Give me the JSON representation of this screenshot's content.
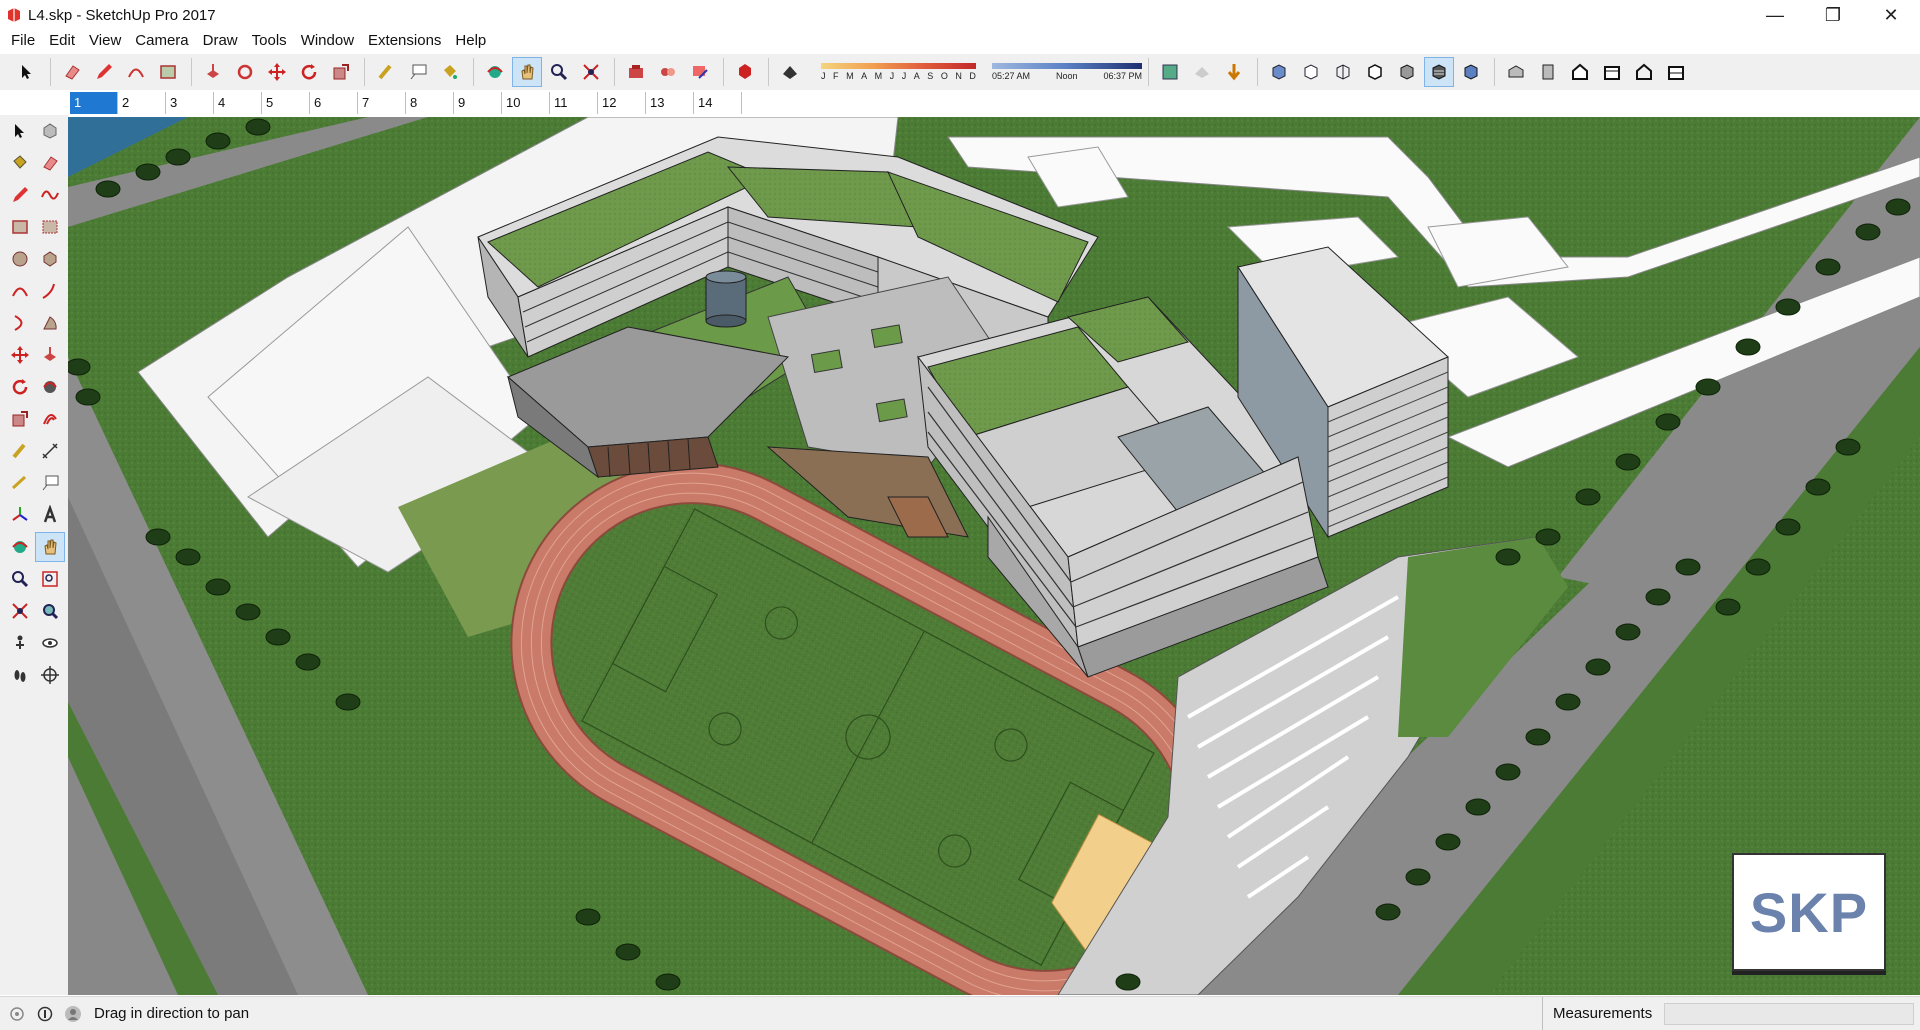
{
  "window": {
    "title": "L4.skp - SketchUp Pro 2017",
    "minimize_glyph": "—",
    "maximize_glyph": "❐",
    "close_glyph": "✕"
  },
  "menu": {
    "items": [
      "File",
      "Edit",
      "View",
      "Camera",
      "Draw",
      "Tools",
      "Window",
      "Extensions",
      "Help"
    ]
  },
  "toolbar": {
    "shadow_months": [
      "J",
      "F",
      "M",
      "A",
      "M",
      "J",
      "J",
      "A",
      "S",
      "O",
      "N",
      "D"
    ],
    "time_start": "05:27 AM",
    "time_mid": "Noon",
    "time_end": "06:37 PM"
  },
  "scenes": {
    "tabs": [
      "1",
      "2",
      "3",
      "4",
      "5",
      "6",
      "7",
      "8",
      "9",
      "10",
      "11",
      "12",
      "13",
      "14"
    ],
    "active_index": 0
  },
  "viewport": {
    "badge_text": "SKP"
  },
  "status": {
    "message": "Drag in direction to pan",
    "measurements_label": "Measurements",
    "measurements_value": ""
  },
  "colors": {
    "accent": "#1f78d1",
    "grass": "#4b7b34",
    "track": "#c97a68",
    "road": "#8a8a8a"
  }
}
